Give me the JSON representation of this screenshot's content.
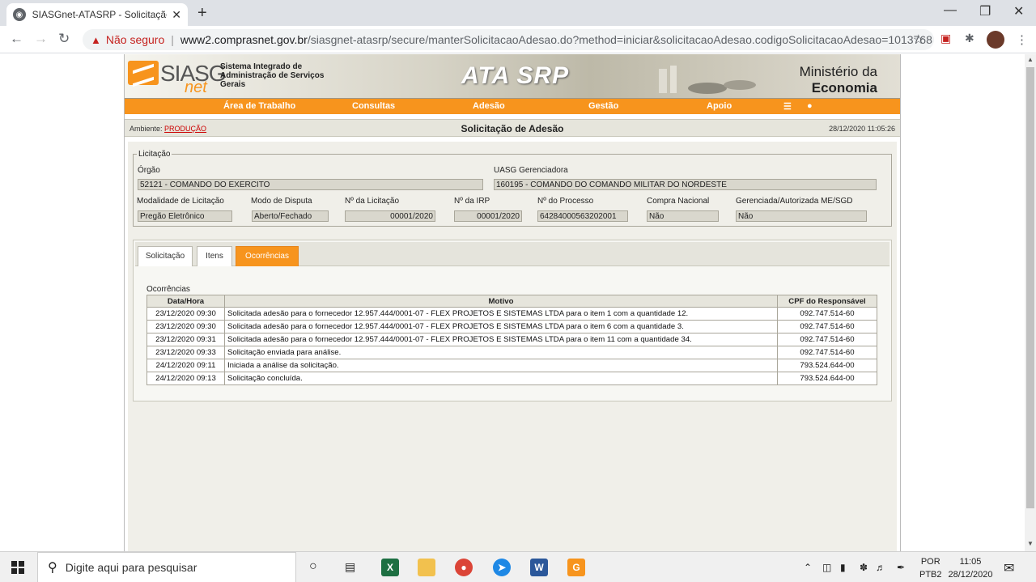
{
  "browser": {
    "tab_title": "SIASGnet-ATASRP - Solicitação de Adesão",
    "tab_favicon": "globe-icon",
    "not_secure": "Não seguro",
    "url_host": "www2.comprasnet.gov.br",
    "url_path": "/siasgnet-atasrp/secure/manterSolicitacaoAdesao.do?method=iniciar&solicitacaoAdesao.codigoSolicitacaoAdesao=1013768"
  },
  "header": {
    "logo_text": "SIASG",
    "logo_net": "net",
    "system_name": "Sistema Integrado de Administração de Serviços Gerais",
    "product": "ATA SRP",
    "ministry_line1": "Ministério da",
    "ministry_line2": "Economia"
  },
  "menu": {
    "items": [
      "Área de Trabalho",
      "Consultas",
      "Adesão",
      "Gestão",
      "Apoio"
    ],
    "accent": "#f7941d"
  },
  "env_bar": {
    "label": "Ambiente:",
    "env": "PRODUÇÃO",
    "title": "Solicitação de Adesão",
    "datetime": "28/12/2020 11:05:26"
  },
  "licitacao": {
    "legend": "Licitação",
    "orgao_label": "Órgão",
    "orgao": "52121 - COMANDO DO EXERCITO",
    "uasg_label": "UASG Gerenciadora",
    "uasg": "160195 - COMANDO DO COMANDO MILITAR DO NORDESTE",
    "modalidade_label": "Modalidade de Licitação",
    "modalidade": "Pregão Eletrônico",
    "disputa_label": "Modo de Disputa",
    "disputa": "Aberto/Fechado",
    "num_lic_label": "Nº da Licitação",
    "num_lic": "00001/2020",
    "num_irp_label": "Nº da IRP",
    "num_irp": "00001/2020",
    "processo_label": "Nº do Processo",
    "processo": "64284000563202001",
    "compra_nacional_label": "Compra Nacional",
    "compra_nacional": "Não",
    "gerenciada_label": "Gerenciada/Autorizada ME/SGD",
    "gerenciada": "Não"
  },
  "tabs": [
    {
      "label": "Solicitação",
      "active": false
    },
    {
      "label": "Itens",
      "active": false
    },
    {
      "label": "Ocorrências",
      "active": true
    }
  ],
  "ocorrencias": {
    "title": "Ocorrências",
    "headers": [
      "Data/Hora",
      "Motivo",
      "CPF do Responsável"
    ],
    "rows": [
      [
        "23/12/2020 09:30",
        "Solicitada adesão para o fornecedor 12.957.444/0001-07 - FLEX PROJETOS E SISTEMAS LTDA para o item 1 com a quantidade 12.",
        "092.747.514-60"
      ],
      [
        "23/12/2020 09:30",
        "Solicitada adesão para o fornecedor 12.957.444/0001-07 - FLEX PROJETOS E SISTEMAS LTDA para o item 6 com a quantidade 3.",
        "092.747.514-60"
      ],
      [
        "23/12/2020 09:31",
        "Solicitada adesão para o fornecedor 12.957.444/0001-07 - FLEX PROJETOS E SISTEMAS LTDA para o item 11 com a quantidade 34.",
        "092.747.514-60"
      ],
      [
        "23/12/2020 09:33",
        "Solicitação enviada para análise.",
        "092.747.514-60"
      ],
      [
        "24/12/2020 09:11",
        "Iniciada a análise da solicitação.",
        "793.524.644-00"
      ],
      [
        "24/12/2020 09:13",
        "Solicitação concluída.",
        "793.524.644-00"
      ]
    ]
  },
  "taskbar": {
    "search_placeholder": "Digite aqui para pesquisar",
    "lang1": "POR",
    "lang2": "PTB2",
    "time": "11:05",
    "date": "28/12/2020"
  }
}
